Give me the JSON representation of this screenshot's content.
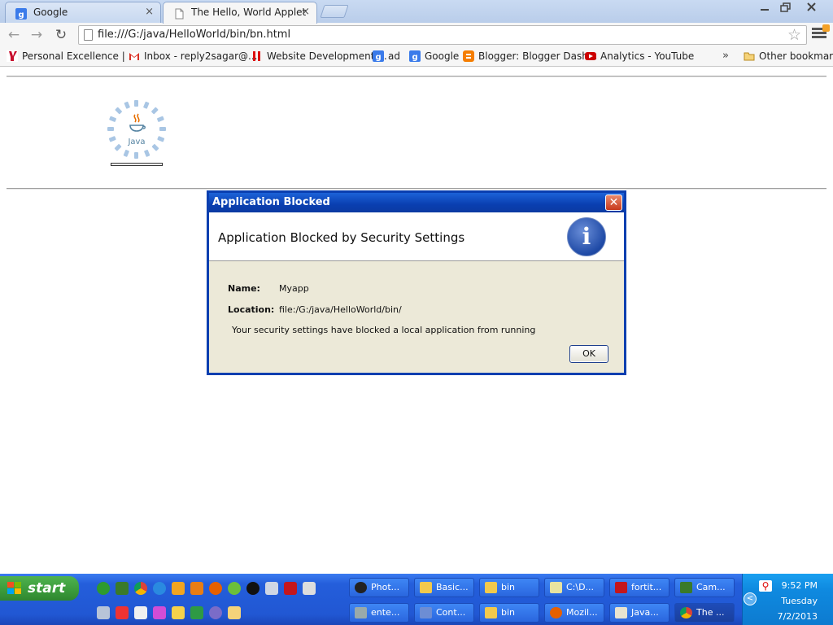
{
  "browser": {
    "tabs": [
      {
        "title": "Google",
        "active": false
      },
      {
        "title": "The Hello, World Applet",
        "active": true
      }
    ],
    "tab_close_glyph": "×",
    "url": "file:///G:/java/HelloWorld/bin/bn.html",
    "bookmarks": [
      {
        "label": "Personal Excellence | ...",
        "icon": "pe-icon",
        "color": "#c8102e"
      },
      {
        "label": "Inbox - reply2sagar@...",
        "icon": "gmail-icon",
        "color": "#d93025"
      },
      {
        "label": "Website Development ...",
        "icon": "site-icon",
        "color": "#d11"
      },
      {
        "label": "ad",
        "icon": "google-icon",
        "color": "#3b7bea"
      },
      {
        "label": "Google",
        "icon": "google-icon",
        "color": "#3b7bea"
      },
      {
        "label": "Blogger: Blogger Dash...",
        "icon": "blogger-icon",
        "color": "#f57d00"
      },
      {
        "label": "Analytics - YouTube",
        "icon": "youtube-icon",
        "color": "#cc0000"
      }
    ],
    "bookmarks_more": "»",
    "other_bookmarks": "Other bookmarks"
  },
  "applet": {
    "logo_text": "Java"
  },
  "dialog": {
    "title": "Application Blocked",
    "heading": "Application Blocked by Security Settings",
    "close_glyph": "✕",
    "info_glyph": "i",
    "name_label": "Name:",
    "name_value": "Myapp",
    "location_label": "Location:",
    "location_value": "file:/G:/java/HelloWorld/bin/",
    "message": "Your security settings have blocked a local application from running",
    "ok_label": "OK"
  },
  "taskbar": {
    "start_label": "start",
    "row1": [
      {
        "label": "Phot...",
        "icon": "photo-icon",
        "color": "#222"
      },
      {
        "label": "Basic...",
        "icon": "folder-icon",
        "color": "#f2c94c"
      },
      {
        "label": "bin",
        "icon": "folder-icon",
        "color": "#f2c94c"
      },
      {
        "label": "C:\\D...",
        "icon": "notepad-icon",
        "color": "#e8e3a0"
      },
      {
        "label": "fortit...",
        "icon": "filezilla-icon",
        "color": "#c4161c"
      },
      {
        "label": "Cam...",
        "icon": "camtasia-icon",
        "color": "#3a7a2a"
      }
    ],
    "row2": [
      {
        "label": "ente...",
        "icon": "pen-icon",
        "color": "#9aa"
      },
      {
        "label": "Cont...",
        "icon": "control-icon",
        "color": "#6d8dd4"
      },
      {
        "label": "bin",
        "icon": "folder-icon",
        "color": "#f2c94c"
      },
      {
        "label": "Mozil...",
        "icon": "firefox-icon",
        "color": "#e66000"
      },
      {
        "label": "Java...",
        "icon": "java-icon",
        "color": "#e8e3d0"
      },
      {
        "label": "The ...",
        "icon": "chrome-icon",
        "color": "#4caf50"
      }
    ],
    "clock_time": "9:52 PM",
    "clock_day": "Tuesday",
    "clock_date": "7/2/2013"
  }
}
